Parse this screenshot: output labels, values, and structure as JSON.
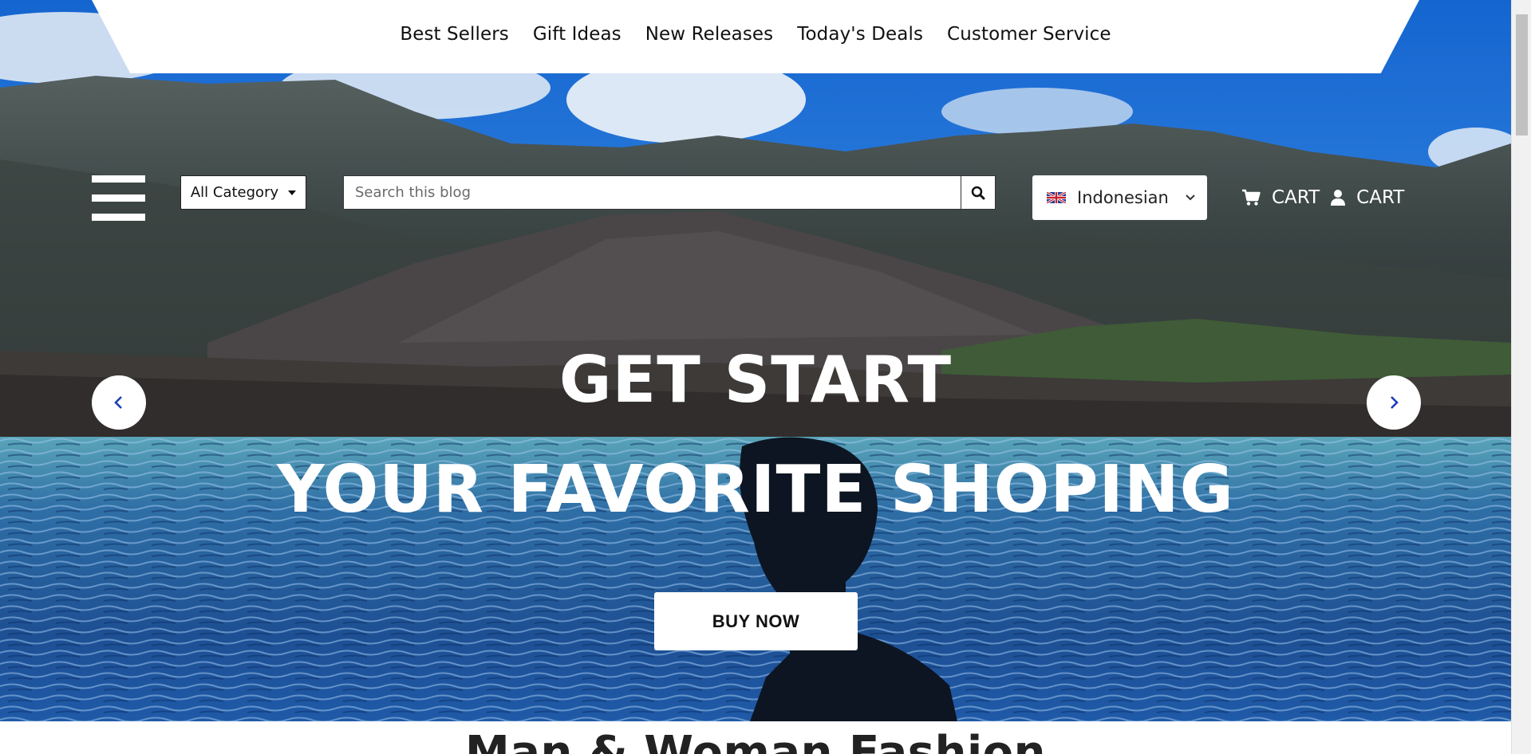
{
  "nav": {
    "links": [
      "Best Sellers",
      "Gift Ideas",
      "New Releases",
      "Today's Deals",
      "Customer Service"
    ]
  },
  "header": {
    "category_label": "All Category",
    "search_placeholder": "Search this blog",
    "language": "Indonesian",
    "cart_label": "CART",
    "account_label": "CART"
  },
  "hero": {
    "headline_1": "GET START",
    "headline_2": "YOUR FAVORITE SHOPING",
    "cta_label": "BUY NOW"
  },
  "section": {
    "title": "Man & Woman Fashion"
  },
  "icons": {
    "menu": "hamburger-icon",
    "search": "search-icon",
    "flag": "uk-flag-icon",
    "language_chevron": "chevron-down-icon",
    "cart": "shopping-cart-icon",
    "user": "user-icon",
    "prev": "chevron-left-icon",
    "next": "chevron-right-icon"
  },
  "colors": {
    "accent_arrow": "#1a3fb8",
    "header_text": "#ffffff",
    "nav_bg": "#ffffff"
  }
}
